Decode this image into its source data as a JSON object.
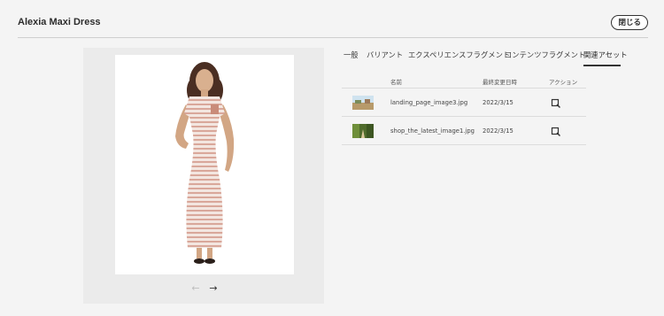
{
  "header": {
    "title": "Alexia Maxi Dress",
    "close_label": "閉じる"
  },
  "preview": {
    "prev_icon": "←",
    "next_icon": "→"
  },
  "tabs": [
    {
      "label": "一般"
    },
    {
      "label": "バリアント"
    },
    {
      "label": "エクスペリエンスフラグメント"
    },
    {
      "label": "コンテンツフラグメント"
    },
    {
      "label": "関連アセット"
    }
  ],
  "table": {
    "headers": {
      "name": "名前",
      "modified": "最終変更日時",
      "actions": "アクション"
    },
    "rows": [
      {
        "name": "landing_page_image3.jpg",
        "modified": "2022/3/15",
        "thumb_icon": "landscape-thumbnail-icon"
      },
      {
        "name": "shop_the_latest_image1.jpg",
        "modified": "2022/3/15",
        "thumb_icon": "forest-path-thumbnail-icon"
      }
    ]
  },
  "colors": {
    "background": "#f4f4f4",
    "panel": "#ebebeb",
    "text": "#2c2c2c"
  }
}
